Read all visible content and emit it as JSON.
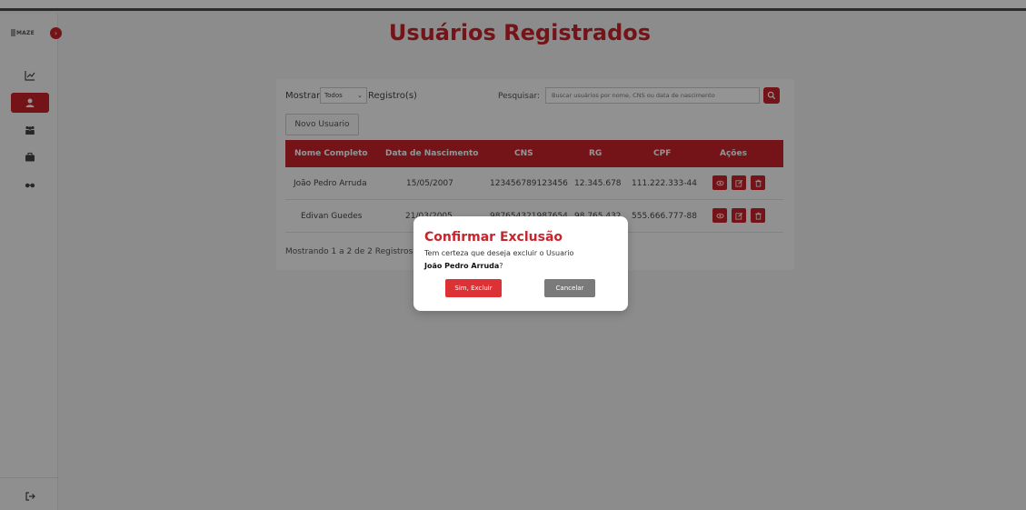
{
  "app": {
    "logo_text": "MAZE",
    "toggle_icon": "chevron-right-icon"
  },
  "sidebar": {
    "items": [
      {
        "name": "chart",
        "icon": "chart-line-icon",
        "active": false
      },
      {
        "name": "users",
        "icon": "user-icon",
        "active": true
      },
      {
        "name": "team",
        "icon": "team-icon",
        "active": false
      },
      {
        "name": "briefcase",
        "icon": "briefcase-icon",
        "active": false
      },
      {
        "name": "glasses",
        "icon": "glasses-icon",
        "active": false
      }
    ],
    "logout_icon": "logout-icon"
  },
  "page": {
    "title": "Usuários Registrados"
  },
  "controls": {
    "show_label": "Mostrar",
    "show_value": "Todos",
    "records_label": "Registro(s)",
    "search_label": "Pesquisar:",
    "search_placeholder": "Buscar usuários por nome, CNS ou data de nascimento",
    "new_user_label": "Novo Usuario"
  },
  "table": {
    "headers": [
      "Nome Completo",
      "Data de Nascimento",
      "CNS",
      "RG",
      "CPF",
      "Ações"
    ],
    "rows": [
      {
        "name": "João Pedro Arruda",
        "birth": "15/05/2007",
        "cns": "123456789123456",
        "rg": "12.345.678",
        "cpf": "111.222.333-44"
      },
      {
        "name": "Edivan Guedes",
        "birth": "21/03/2005",
        "cns": "987654321987654",
        "rg": "98.765.432",
        "cpf": "555.666.777-88"
      }
    ],
    "footer": "Mostrando 1 a 2 de 2 Registros"
  },
  "modal": {
    "title": "Confirmar Exclusão",
    "message": "Tem certeza que deseja excluir o Usuario",
    "user_name": "João Pedro Arruda",
    "suffix": "?",
    "confirm_label": "Sim, Excluir",
    "cancel_label": "Cancelar"
  },
  "colors": {
    "accent": "#c8242b",
    "danger": "#dc3236",
    "cancel": "#7a7a7a"
  }
}
